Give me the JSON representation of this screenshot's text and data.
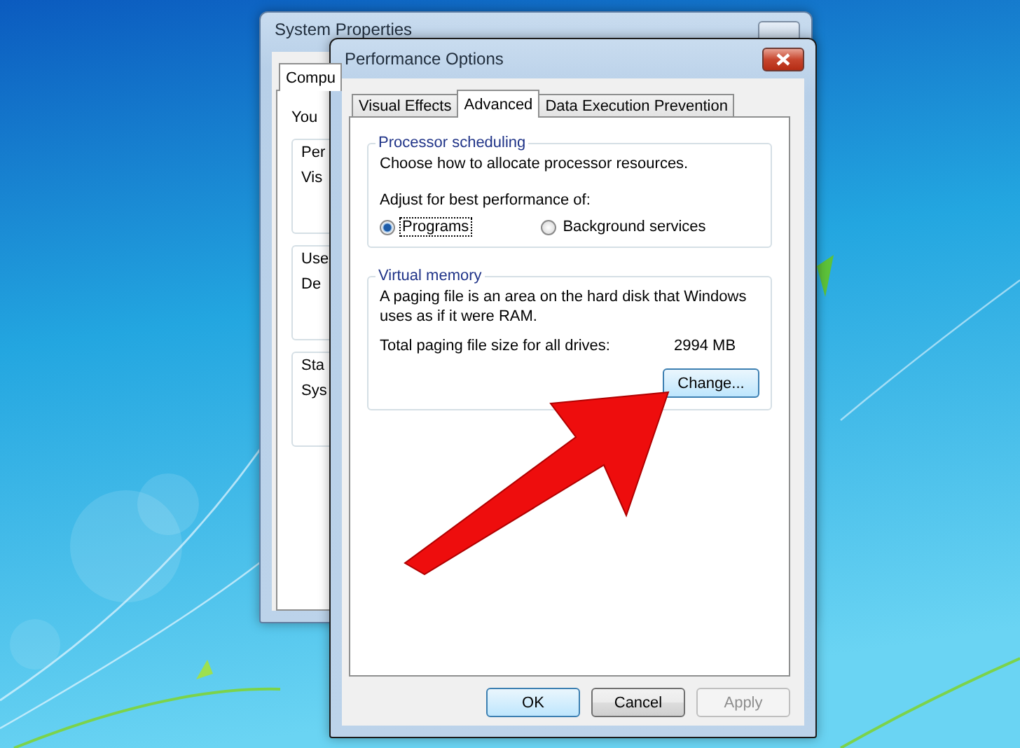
{
  "system_properties": {
    "title": "System Properties",
    "tabs": [
      {
        "label": "Compu",
        "selected": true
      }
    ],
    "intro": "You",
    "groups": [
      {
        "label": "Per",
        "lines": [
          "Vis"
        ]
      },
      {
        "label": "Use",
        "lines": [
          "De"
        ]
      },
      {
        "label": "Sta",
        "lines": [
          "Sys"
        ]
      }
    ]
  },
  "performance_options": {
    "title": "Performance Options",
    "tabs": [
      {
        "label": "Visual Effects",
        "selected": false
      },
      {
        "label": "Advanced",
        "selected": true
      },
      {
        "label": "Data Execution Prevention",
        "selected": false
      }
    ],
    "processor_scheduling": {
      "label": "Processor scheduling",
      "description": "Choose how to allocate processor resources.",
      "prompt": "Adjust for best performance of:",
      "options": [
        {
          "label": "Programs",
          "selected": true,
          "focused": true
        },
        {
          "label": "Background services",
          "selected": false,
          "focused": false
        }
      ]
    },
    "virtual_memory": {
      "label": "Virtual memory",
      "description": "A paging file is an area on the hard disk that Windows uses as if it were RAM.",
      "total_label": "Total paging file size for all drives:",
      "total_value": "2994 MB",
      "button": "Change..."
    },
    "buttons": [
      {
        "label": "OK",
        "default": true,
        "disabled": false
      },
      {
        "label": "Cancel",
        "default": false,
        "disabled": false
      },
      {
        "label": "Apply",
        "default": false,
        "disabled": true
      }
    ]
  }
}
